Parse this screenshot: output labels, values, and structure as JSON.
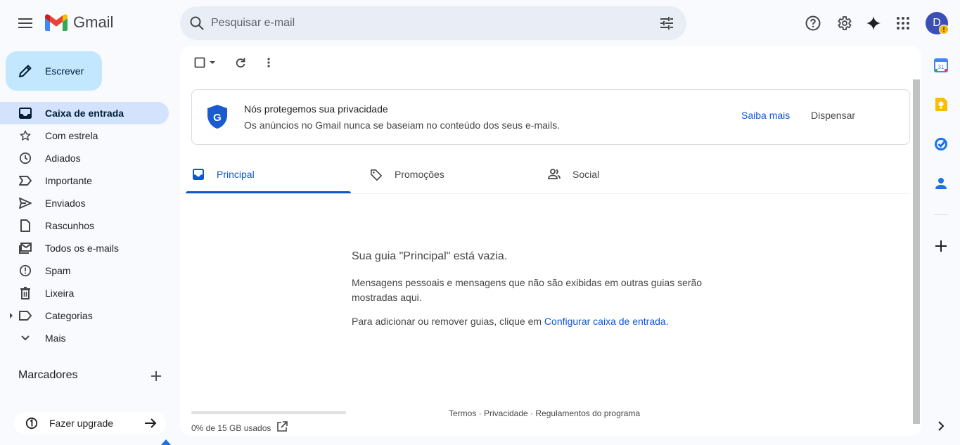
{
  "app": {
    "logo_text": "Gmail"
  },
  "search": {
    "placeholder": "Pesquisar e-mail"
  },
  "avatar": {
    "initial": "D",
    "badge": "!"
  },
  "compose": {
    "label": "Escrever"
  },
  "sidebar": {
    "items": [
      {
        "label": "Caixa de entrada",
        "icon": "inbox-icon",
        "active": true
      },
      {
        "label": "Com estrela",
        "icon": "star-icon"
      },
      {
        "label": "Adiados",
        "icon": "clock-icon"
      },
      {
        "label": "Importante",
        "icon": "important-icon"
      },
      {
        "label": "Enviados",
        "icon": "send-icon"
      },
      {
        "label": "Rascunhos",
        "icon": "draft-icon"
      },
      {
        "label": "Todos os e-mails",
        "icon": "all-mail-icon"
      },
      {
        "label": "Spam",
        "icon": "spam-icon"
      },
      {
        "label": "Lixeira",
        "icon": "trash-icon"
      },
      {
        "label": "Categorias",
        "icon": "label-icon"
      },
      {
        "label": "Mais",
        "icon": "chevron-down-icon"
      }
    ],
    "labels_title": "Marcadores",
    "upgrade_label": "Fazer upgrade"
  },
  "banner": {
    "title": "Nós protegemos sua privacidade",
    "subtitle": "Os anúncios no Gmail nunca se baseiam no conteúdo dos seus e-mails.",
    "learn_more": "Saiba mais",
    "dismiss": "Dispensar"
  },
  "tabs": [
    {
      "label": "Principal",
      "active": true
    },
    {
      "label": "Promoções"
    },
    {
      "label": "Social"
    }
  ],
  "empty_state": {
    "title": "Sua guia \"Principal\" está vazia.",
    "description": "Mensagens pessoais e mensagens que não são exibidas em outras guias serão mostradas aqui.",
    "config_prefix": "Para adicionar ou remover guias, clique em ",
    "config_link": "Configurar caixa de entrada."
  },
  "storage": {
    "used_text": "0% de 15 GB usados",
    "percent_used": 0
  },
  "footer": {
    "links_text": "Termos · Privacidade · Regulamentos do programa"
  },
  "colors": {
    "accent": "#0b57d0",
    "compose_bg": "#c2e7ff",
    "active_nav_bg": "#d3e3fd"
  }
}
